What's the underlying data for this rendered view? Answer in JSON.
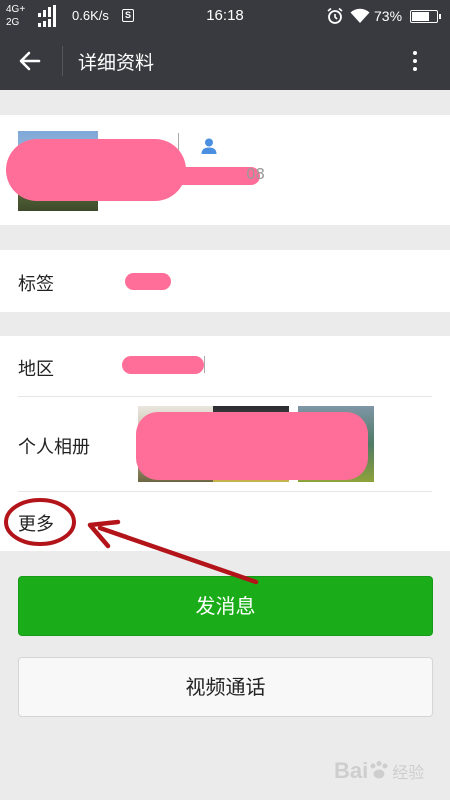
{
  "status_bar": {
    "network_top": "4G+",
    "network_bottom": "2G",
    "speed": "0.6K/s",
    "speed_badge": "S",
    "time": "16:18",
    "battery_percent": "73%",
    "battery_level": 0.73,
    "icons": [
      "signal-icon",
      "alarm-icon",
      "wifi-icon",
      "battery-icon"
    ]
  },
  "header": {
    "title": "详细资料",
    "back_icon": "arrow-left-icon",
    "menu_icon": "more-vertical-icon"
  },
  "profile": {
    "id_suffix": "08",
    "verify_icon": "user-icon"
  },
  "rows": {
    "tag_label": "标签",
    "region_label": "地区",
    "album_label": "个人相册",
    "more_label": "更多"
  },
  "buttons": {
    "message": "发消息",
    "video_call": "视频通话"
  },
  "watermark": {
    "brand": "Bai",
    "suffix": "经验"
  },
  "colors": {
    "header_bg": "#393a3f",
    "primary_green": "#1aad19",
    "redaction": "#ff6e98",
    "annotation_red": "#b3141a"
  }
}
